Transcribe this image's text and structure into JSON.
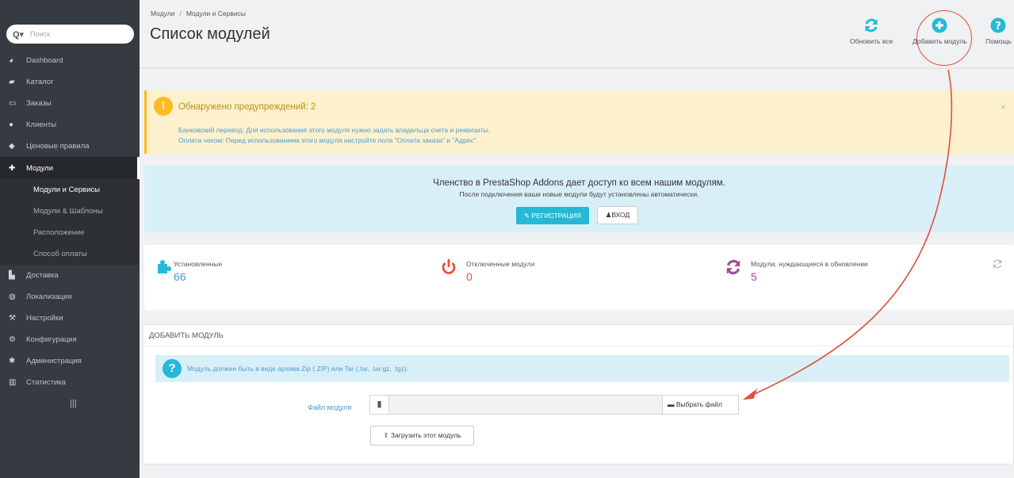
{
  "sidebar": {
    "search_icon": "search-icon",
    "search_placeholder": "Поиск",
    "items": [
      {
        "label": "Dashboard",
        "icon": "dashboard-icon"
      },
      {
        "label": "Каталог",
        "icon": "book-icon"
      },
      {
        "label": "Заказы",
        "icon": "credit-card-icon"
      },
      {
        "label": "Клиенты",
        "icon": "users-icon"
      },
      {
        "label": "Ценовые правила",
        "icon": "tag-icon"
      },
      {
        "label": "Модули",
        "icon": "puzzle-icon"
      },
      {
        "label": "Доставка",
        "icon": "truck-icon"
      },
      {
        "label": "Локализация",
        "icon": "globe-icon"
      },
      {
        "label": "Настройки",
        "icon": "wrench-icon"
      },
      {
        "label": "Конфигурация",
        "icon": "cogs-icon"
      },
      {
        "label": "Администрация",
        "icon": "gear-icon"
      },
      {
        "label": "Статистика",
        "icon": "bar-chart-icon"
      }
    ],
    "submenu": [
      "Модули и Сервисы",
      "Модули & Шаблоны",
      "Расположение",
      "Способ оплаты"
    ]
  },
  "header": {
    "breadcrumb": [
      "Модули",
      "Модули и Сервисы"
    ],
    "title": "Список модулей"
  },
  "toolbar": {
    "refresh_label": "Обновить все",
    "add_label": "Добавить модуль",
    "help_label": "Помощь"
  },
  "warning": {
    "title": "Обнаружено предупреждений: 2",
    "lines": [
      "Банковский перевод: Для использования этого модуля нужно задать владельца счета и реквизиты.",
      "Оплата чеком: Перед использованием этого модуля настройте поля \"Оплата заказа\" и \"Адрес\"."
    ],
    "close": "×"
  },
  "addons": {
    "title": "Членство в PrestaShop Addons дает доступ ко всем нашим модулям.",
    "subtitle": "После подключения ваши новые модули будут установлены автоматически.",
    "register_label": "РЕГИСТРАЦИЯ",
    "login_label": "ВХОД"
  },
  "stats": {
    "installed": {
      "label": "Установленные",
      "value": "66",
      "color": "#4a9dd1"
    },
    "disabled": {
      "label": "Отключенные модули",
      "value": "0",
      "color": "#e84e3c"
    },
    "updates": {
      "label": "Модули, нуждающиеся в обновлении",
      "value": "5",
      "color": "#a24d9d"
    }
  },
  "add_module": {
    "heading": "ДОБАВИТЬ МОДУЛЬ",
    "info": "Модуль должен быть в виде архива Zip (.ZIP) или Tar (.tar, .tar.gz, .tgz).",
    "file_label": "Файл модуля",
    "choose_label": "Выбрать файл",
    "upload_label": "Загрузить этот модуль"
  },
  "colors": {
    "sidebar_bg": "#363a41",
    "accent": "#25b9d7",
    "warning": "#fbbb22",
    "annotation": "#e0503a"
  }
}
